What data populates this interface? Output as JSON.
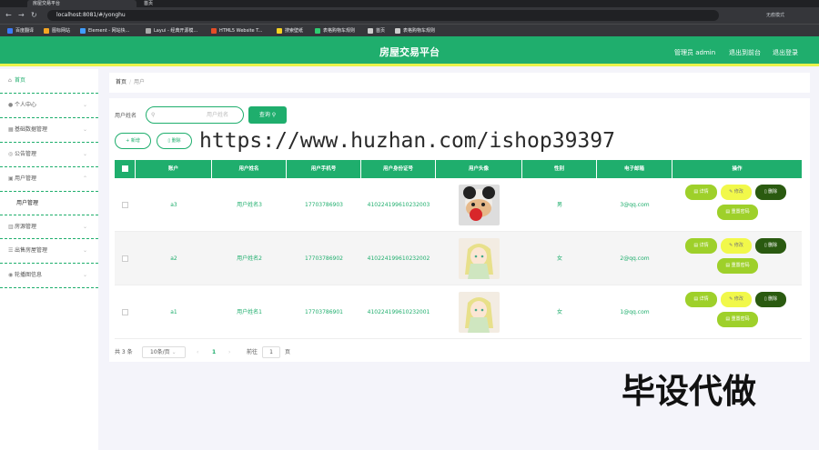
{
  "browser": {
    "tabs": [
      "房屋交易平台",
      "首页"
    ],
    "url": "localhost:8081/#/yonghu",
    "profile_label": "无痕模式",
    "bookmarks": [
      "百度翻译",
      "图标网站",
      "Element - 网站快...",
      "Layui - 经典开源模...",
      "HTML5 Website T...",
      "搜索壁纸",
      "表格购物车规则",
      "首页",
      "表格购物车规则"
    ]
  },
  "header": {
    "title": "房屋交易平台",
    "admin_label": "管理员 admin",
    "back_label": "退出到前台",
    "logout_label": "退出登录"
  },
  "sidebar": {
    "items": [
      {
        "label": "首页",
        "icon": "home-icon"
      },
      {
        "label": "个人中心",
        "icon": "user-icon"
      },
      {
        "label": "基础数据管理",
        "icon": "grid-icon"
      },
      {
        "label": "公告管理",
        "icon": "notice-icon"
      },
      {
        "label": "用户管理",
        "icon": "users-icon"
      },
      {
        "label": "用户管理",
        "icon": ""
      },
      {
        "label": "房源管理",
        "icon": "house-icon"
      },
      {
        "label": "出售房屋管理",
        "icon": "list-icon"
      },
      {
        "label": "轮播图信息",
        "icon": "image-icon"
      }
    ]
  },
  "breadcrumb": {
    "home": "首页",
    "sep": "/",
    "current": "用户"
  },
  "search": {
    "label": "用户姓名",
    "placeholder": "用户姓名",
    "button": "查询"
  },
  "actions": {
    "add": "+ 新增",
    "delete": "删除"
  },
  "table": {
    "columns": [
      "账户",
      "用户姓名",
      "用户手机号",
      "用户身份证号",
      "用户头像",
      "性别",
      "电子邮箱",
      "操作"
    ],
    "rows": [
      {
        "account": "a3",
        "name": "用户姓名3",
        "phone": "17703786903",
        "idcard": "410224199610232003",
        "gender": "男",
        "email": "3@qq.com"
      },
      {
        "account": "a2",
        "name": "用户姓名2",
        "phone": "17703786902",
        "idcard": "410224199610232002",
        "gender": "女",
        "email": "2@qq.com"
      },
      {
        "account": "a1",
        "name": "用户姓名1",
        "phone": "17703786901",
        "idcard": "410224199610232001",
        "gender": "女",
        "email": "1@qq.com"
      }
    ],
    "ops": {
      "detail": "详情",
      "edit": "修改",
      "delete": "删除",
      "reset": "重置密码"
    }
  },
  "pagination": {
    "total": "共 3 条",
    "page_size": "10条/页",
    "current_page": "1",
    "goto_label": "前往",
    "goto_value": "1",
    "page_unit": "页"
  },
  "overlay": {
    "watermark": "https://www.huzhan.com/ishop39397",
    "stamp": "毕设代做"
  },
  "colors": {
    "primary": "#1fae6d",
    "accent_bar": "#e9f34a",
    "detail": "#9ed02a",
    "edit": "#f1f84a",
    "delete": "#2a5a10"
  }
}
